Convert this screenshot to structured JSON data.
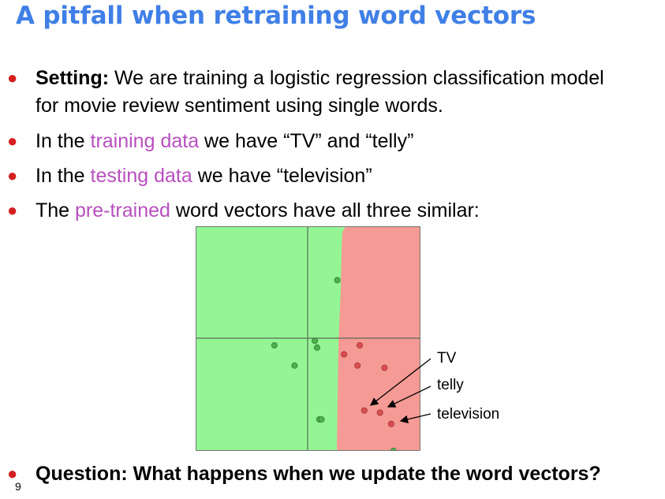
{
  "slide": {
    "title": "A pitfall when retraining word vectors",
    "bullets": [
      {
        "bold": "Setting:",
        "text": " We are training a logistic regression classification model"
      },
      {
        "text": "for movie review sentiment using single words."
      },
      {
        "pre": "In the ",
        "highlight": "training data",
        "post": " we have “TV” and “telly”"
      },
      {
        "pre": "In the ",
        "highlight": "testing data",
        "post": " we have “television”"
      },
      {
        "pre": "The ",
        "highlight": "pre-trained",
        "post": " word vectors have all three similar:"
      }
    ],
    "question": "Question: What happens when we update the word vectors?",
    "page_number": "9"
  },
  "figure": {
    "labels": [
      "TV",
      "telly",
      "television"
    ],
    "colors": {
      "positive_region": "#94f594",
      "negative_region": "#f59a94",
      "positive_point": "#4faf4f",
      "negative_point": "#d94f4f",
      "accent": "#3f7fe6",
      "highlight": "#b750be",
      "bullet": "#d41f1f"
    },
    "points": [
      {
        "class": "positive",
        "x": 0.63,
        "y": 0.76
      },
      {
        "class": "positive",
        "x": 0.35,
        "y": 0.47
      },
      {
        "class": "positive",
        "x": 0.53,
        "y": 0.49
      },
      {
        "class": "positive",
        "x": 0.54,
        "y": 0.46
      },
      {
        "class": "positive",
        "x": 0.44,
        "y": 0.38
      },
      {
        "class": "positive",
        "x": 0.55,
        "y": 0.14
      },
      {
        "class": "positive",
        "x": 0.56,
        "y": 0.14
      },
      {
        "class": "positive",
        "x": 0.88,
        "y": 0.0
      },
      {
        "class": "negative",
        "x": 0.73,
        "y": 0.47
      },
      {
        "class": "negative",
        "x": 0.66,
        "y": 0.43
      },
      {
        "class": "negative",
        "x": 0.72,
        "y": 0.38
      },
      {
        "class": "negative",
        "x": 0.84,
        "y": 0.37
      },
      {
        "class": "negative",
        "x": 0.75,
        "y": 0.18
      },
      {
        "class": "negative",
        "x": 0.82,
        "y": 0.17
      },
      {
        "class": "negative",
        "x": 0.87,
        "y": 0.12
      }
    ]
  }
}
